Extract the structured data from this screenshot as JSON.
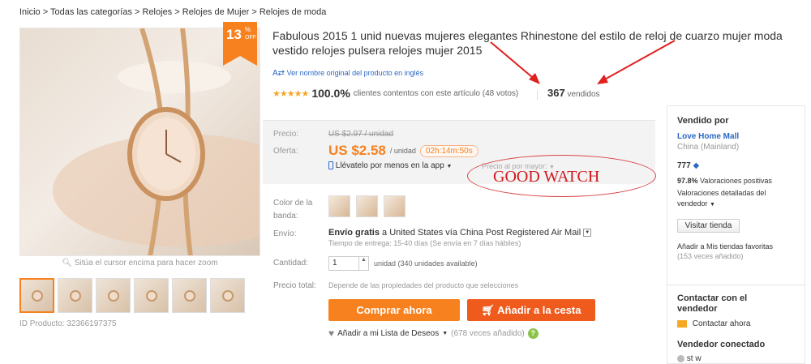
{
  "breadcrumb": [
    "Inicio",
    "Todas las categorías",
    "Relojes",
    "Relojes de Mujer",
    "Relojes de moda"
  ],
  "breadcrumb_sep": ">",
  "sale": {
    "percent": "13",
    "pct_sign": "%",
    "off": "OFF"
  },
  "image_hint": "Sitúa el cursor encima para hacer zoom",
  "product_id": "ID Producto: 32366197375",
  "title": "Fabulous 2015 1 unid nuevas mujeres elegantes Rhinestone del estilo de reloj de cuarzo mujer moda vestido relojes pulsera relojes mujer 2015",
  "original_name_link": "Ver nombre original del producto en inglés",
  "rating": {
    "stars": "★★★★★",
    "percent": "100.0%",
    "text": "clientes contentos con este artículo (48 votos)"
  },
  "sold": {
    "count": "367",
    "label": "vendidos"
  },
  "price": {
    "label_price": "Precio:",
    "old": "US $2.97 / unidad",
    "label_offer": "Oferta:",
    "current": "US $2.58",
    "unit": "/ unidad",
    "timer": "02h:14m:50s",
    "app_link": "Llévatelo por menos en la app",
    "wholesale": "Precio al por mayor:"
  },
  "annotation": "GOOD WATCH",
  "options": {
    "band_color_label_1": "Color de la",
    "band_color_label_2": "banda:",
    "shipping_label": "Envío:",
    "shipping_free": "Envío gratis",
    "shipping_text": "a United States vía China Post Registered Air Mail",
    "delivery": "Tiempo de entrega: 15-40 días (Se envía en 7 días hábiles)",
    "qty_label": "Cantidad:",
    "qty_value": "1",
    "qty_available": "unidad (340 unidades available)",
    "total_label": "Precio total:",
    "total_text": "Depende de las propiedades del producto que selecciones"
  },
  "buttons": {
    "buy": "Comprar ahora",
    "cart": "Añadir a la cesta"
  },
  "wishlist": {
    "label": "Añadir a mi Lista de Deseos",
    "count": "(678 veces añadido)"
  },
  "seller": {
    "title": "Vendido por",
    "name": "Love Home Mall",
    "country": "China (Mainland)",
    "score": "777",
    "positive_pct": "97.8%",
    "positive_text": "Valoraciones positivas",
    "detailed_1": "Valoraciones detalladas del",
    "detailed_2": "vendedor",
    "visit": "Visitar tienda",
    "fav_1": "Añadir a Mis tiendas favoritas",
    "fav_2": "(153 veces añadido)",
    "contact_title_1": "Contactar con el",
    "contact_title_2": "vendedor",
    "contact_now": "Contactar ahora",
    "connected_title": "Vendedor conectado",
    "connected_name": "st w"
  },
  "colors": {
    "accent": "#f7811e",
    "link": "#2c68c5",
    "annotation": "#d0191d"
  }
}
